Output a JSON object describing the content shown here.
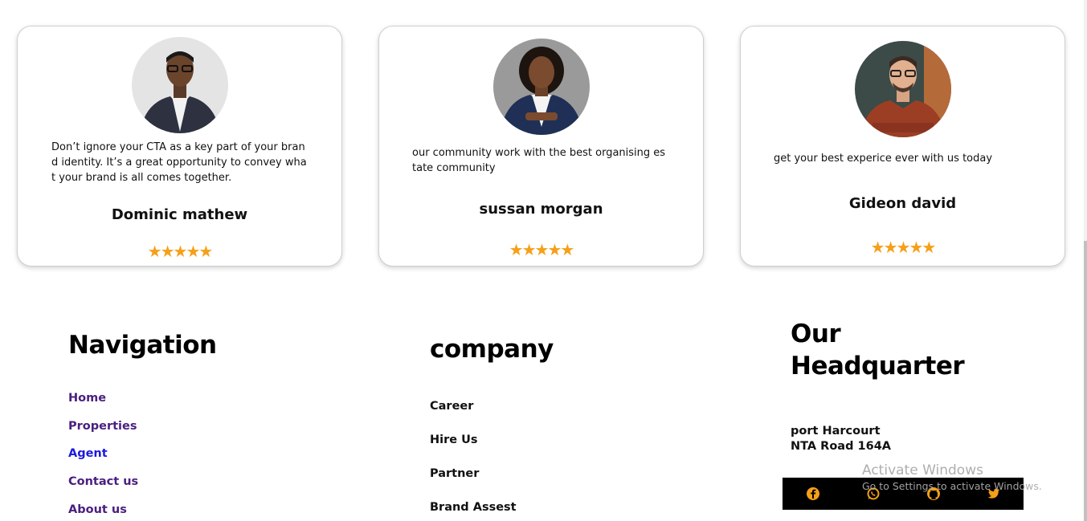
{
  "testimonials": [
    {
      "quote": "Don’t ignore your CTA as a key part of your brand identity. It’s a great opportunity to convey what your brand is all comes together.",
      "name": "Dominic mathew",
      "stars": "★★★★★",
      "rating": 5
    },
    {
      "quote": "our community work with the best organising estate community",
      "name": "sussan morgan",
      "stars": "★★★★★",
      "rating": 5
    },
    {
      "quote": "get your best experice ever with us today",
      "name": "Gideon david",
      "stars": "★★★★★",
      "rating": 5
    }
  ],
  "footer": {
    "navigation": {
      "heading": "Navigation",
      "links": [
        "Home",
        "Properties",
        "Agent",
        "Contact us",
        "About us"
      ]
    },
    "company": {
      "heading": "company",
      "links": [
        "Career",
        "Hire Us",
        "Partner",
        "Brand Assest"
      ]
    },
    "headquarter": {
      "heading_line1": "Our",
      "heading_line2": "Headquarter",
      "address_line1": "port Harcourt",
      "address_line2": "NTA Road 164A"
    },
    "social": [
      "facebook-icon",
      "whatsapp-icon",
      "github-icon",
      "twitter-icon"
    ]
  },
  "watermark": {
    "title": "Activate Windows",
    "subtitle": "Go to Settings to activate Windows."
  },
  "colors": {
    "star": "#f5a018",
    "nav_link": "#4a2080",
    "nav_link_active": "#1a1adf",
    "social_bar": "#000000",
    "social_icon": "#f5a018"
  }
}
